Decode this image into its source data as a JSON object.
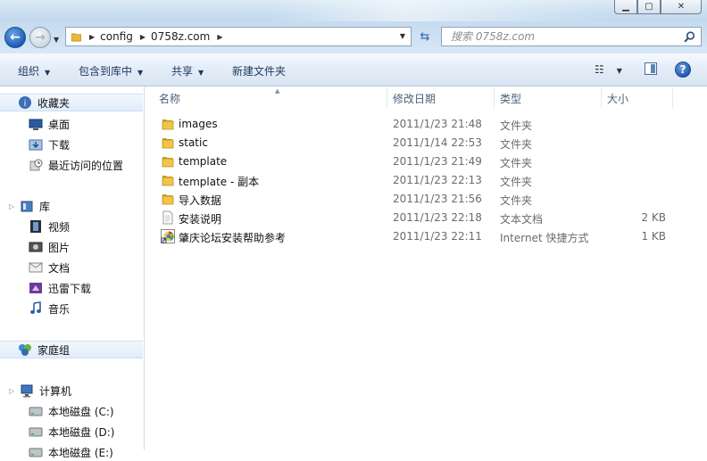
{
  "window": {
    "min_label": "▭",
    "max_label": "▢",
    "close_label": "✕"
  },
  "address": {
    "crumbs": [
      "config",
      "0758z.com"
    ],
    "search_placeholder": "搜索 0758z.com"
  },
  "toolbar": {
    "organize": "组织",
    "include_in_library": "包含到库中",
    "share": "共享",
    "new_folder": "新建文件夹"
  },
  "nav": {
    "favorites": "收藏夹",
    "favorites_items": [
      "桌面",
      "下载",
      "最近访问的位置"
    ],
    "libraries": "库",
    "libraries_items": [
      "视频",
      "图片",
      "文档",
      "迅雷下载",
      "音乐"
    ],
    "homegroup": "家庭组",
    "computer": "计算机",
    "computer_items": [
      "本地磁盘 (C:)",
      "本地磁盘 (D:)",
      "本地磁盘 (E:)"
    ]
  },
  "columns": {
    "name": "名称",
    "date": "修改日期",
    "type": "类型",
    "size": "大小"
  },
  "files": [
    {
      "name": "images",
      "date": "2011/1/23 21:48",
      "type": "文件夹",
      "size": "",
      "icon": "folder-icon"
    },
    {
      "name": "static",
      "date": "2011/1/14 22:53",
      "type": "文件夹",
      "size": "",
      "icon": "folder-icon"
    },
    {
      "name": "template",
      "date": "2011/1/23 21:49",
      "type": "文件夹",
      "size": "",
      "icon": "folder-icon"
    },
    {
      "name": "template - 副本",
      "date": "2011/1/23 22:13",
      "type": "文件夹",
      "size": "",
      "icon": "folder-icon"
    },
    {
      "name": "导入数据",
      "date": "2011/1/23 21:56",
      "type": "文件夹",
      "size": "",
      "icon": "folder-icon"
    },
    {
      "name": "安装说明",
      "date": "2011/1/23 22:18",
      "type": "文本文档",
      "size": "2 KB",
      "icon": "text-file-icon"
    },
    {
      "name": "肇庆论坛安装帮助参考",
      "date": "2011/1/23 22:11",
      "type": "Internet 快捷方式",
      "size": "1 KB",
      "icon": "internet-shortcut-icon"
    }
  ],
  "colors": {
    "folder": "#e8b936",
    "accent": "#1d5bb5"
  }
}
